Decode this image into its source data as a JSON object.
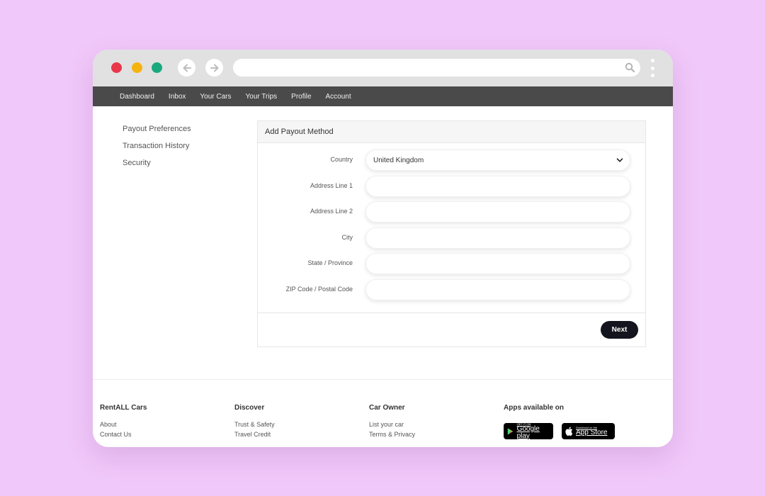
{
  "colors": {
    "background": "#f1c8fa",
    "close_dot": "#e8374a",
    "minimize_dot": "#f6b30f",
    "maximize_dot": "#1aa97f",
    "nav_bar": "#4a4a4a",
    "primary_button": "#14141e"
  },
  "browser": {
    "back_icon": "arrow-left-icon",
    "forward_icon": "arrow-right-icon",
    "search_icon": "search-icon",
    "menu_icon": "kebab-menu-icon"
  },
  "nav": {
    "items": [
      "Dashboard",
      "Inbox",
      "Your Cars",
      "Your Trips",
      "Profile",
      "Account"
    ]
  },
  "sidebar": {
    "items": [
      "Payout Preferences",
      "Transaction History",
      "Security"
    ]
  },
  "form": {
    "title": "Add Payout Method",
    "country_label": "Country",
    "country_value": "United Kingdom",
    "address1_label": "Address Line 1",
    "address2_label": "Address Line 2",
    "city_label": "City",
    "state_label": "State / Province",
    "zip_label": "ZIP Code / Postal Code",
    "next_label": "Next"
  },
  "footer": {
    "col1": {
      "title": "RentALL Cars",
      "links": [
        "About",
        "Contact Us"
      ]
    },
    "col2": {
      "title": "Discover",
      "links": [
        "Trust & Safety",
        "Travel Credit"
      ]
    },
    "col3": {
      "title": "Car Owner",
      "links": [
        "List your car",
        "Terms & Privacy"
      ]
    },
    "apps": {
      "title": "Apps available on",
      "google_small": "GET IT ON",
      "google_big": "Google play",
      "apple_small": "Download on the",
      "apple_big": "App Store"
    }
  }
}
